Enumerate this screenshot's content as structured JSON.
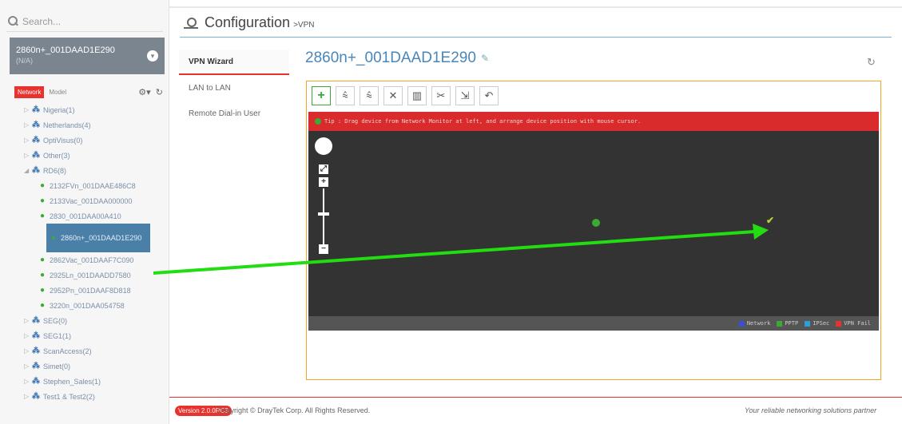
{
  "search": {
    "placeholder": "Search..."
  },
  "device_card": {
    "name": "2860n+_001DAAD1E290",
    "sub": "(N/A)"
  },
  "sidebar_tabs": {
    "network": "Network",
    "model": "Model"
  },
  "tree": [
    {
      "type": "group",
      "label": "Nigeria(1)"
    },
    {
      "type": "group",
      "label": "Netherlands(4)"
    },
    {
      "type": "group",
      "label": "OptiVisus(0)"
    },
    {
      "type": "group",
      "label": "Other(3)"
    },
    {
      "type": "group",
      "label": "RD6(8)",
      "expanded": true
    },
    {
      "type": "child",
      "label": "2132FVn_001DAAE486C8"
    },
    {
      "type": "child",
      "label": "2133Vac_001DAA000000"
    },
    {
      "type": "child",
      "label": "2830_001DAA00A410"
    },
    {
      "type": "selected",
      "label": "2860n+_001DAAD1E290"
    },
    {
      "type": "child",
      "label": "2862Vac_001DAAF7C090"
    },
    {
      "type": "child",
      "label": "2925Ln_001DAADD7580"
    },
    {
      "type": "child",
      "label": "2952Pn_001DAAF8D818"
    },
    {
      "type": "child",
      "label": "3220n_001DAA054758"
    },
    {
      "type": "group",
      "label": "SEG(0)"
    },
    {
      "type": "group",
      "label": "SEG1(1)"
    },
    {
      "type": "group",
      "label": "ScanAccess(2)"
    },
    {
      "type": "group",
      "label": "Simet(0)"
    },
    {
      "type": "group",
      "label": "Stephen_Sales(1)"
    },
    {
      "type": "group",
      "label": "Test1 & Test2(2)"
    }
  ],
  "header": {
    "title": "Configuration",
    "breadcrumb": ">VPN"
  },
  "submenu": [
    {
      "label": "VPN Wizard",
      "active": true
    },
    {
      "label": "LAN to LAN",
      "active": false
    },
    {
      "label": "Remote Dial-in User",
      "active": false
    }
  ],
  "main": {
    "device_title": "2860n+_001DAAD1E290"
  },
  "wizard": {
    "toolbar_icons": [
      "add-icon",
      "connect-icon",
      "disconnect-icon",
      "tools-icon",
      "delete-icon",
      "cut-icon",
      "export-icon",
      "undo-icon"
    ],
    "tip": "Tip : Drag device from Network Monitor at left, and arrange device position with mouse cursor.",
    "legend": [
      {
        "label": "Network",
        "color": "#3a4fd8"
      },
      {
        "label": "PPTP",
        "color": "#3aaa35"
      },
      {
        "label": "IPSec",
        "color": "#2a9fd8"
      },
      {
        "label": "VPN Fail",
        "color": "#e8322e"
      }
    ]
  },
  "footer": {
    "version": "Version 2.0.0RC3",
    "copyright": "Copyright © DrayTek Corp. All Rights Reserved.",
    "tagline": "Your reliable networking solutions partner"
  },
  "colors": {
    "accent_red": "#e8322e",
    "accent_blue": "#4a86b8",
    "arrow_green": "#22dd11",
    "panel_border": "#f5a623"
  }
}
